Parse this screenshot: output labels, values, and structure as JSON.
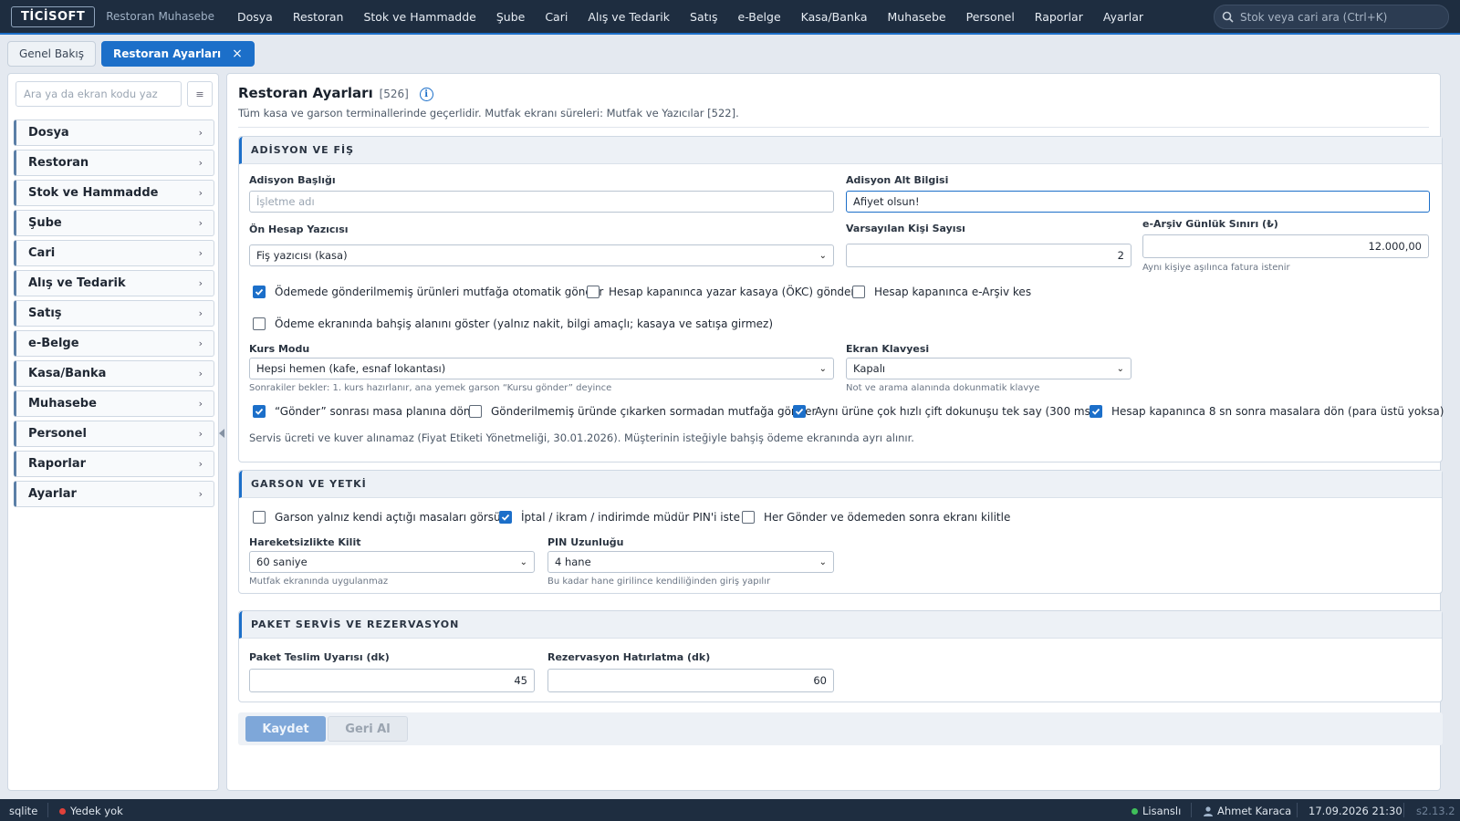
{
  "app": {
    "logo": "TİCİSOFT",
    "name": "Restoran Muhasebe"
  },
  "menu": [
    "Dosya",
    "Restoran",
    "Stok ve Hammadde",
    "Şube",
    "Cari",
    "Alış ve Tedarik",
    "Satış",
    "e-Belge",
    "Kasa/Banka",
    "Muhasebe",
    "Personel",
    "Raporlar",
    "Ayarlar"
  ],
  "search": {
    "placeholder": "Stok veya cari ara (Ctrl+K)"
  },
  "tabs": [
    {
      "label": "Genel Bakış",
      "active": false
    },
    {
      "label": "Restoran Ayarları",
      "active": true,
      "close": "×"
    }
  ],
  "sidebar": {
    "search_placeholder": "Ara ya da ekran kodu yaz",
    "items": [
      "Dosya",
      "Restoran",
      "Stok ve Hammadde",
      "Şube",
      "Cari",
      "Alış ve Tedarik",
      "Satış",
      "e-Belge",
      "Kasa/Banka",
      "Muhasebe",
      "Personel",
      "Raporlar",
      "Ayarlar"
    ]
  },
  "page": {
    "title": "Restoran Ayarları",
    "code": "[526]",
    "subtitle": "Tüm kasa ve garson terminallerinde geçerlidir. Mutfak ekranı süreleri: Mutfak ve Yazıcılar [522]."
  },
  "adisyon": {
    "heading": "ADİSYON VE FİŞ",
    "baslik_label": "Adisyon Başlığı",
    "baslik_placeholder": "İşletme adı",
    "baslik_value": "",
    "altbilgi_label": "Adisyon Alt Bilgisi",
    "altbilgi_value": "Afiyet olsun!",
    "yazici_label": "Ön Hesap Yazıcısı",
    "yazici_value": "Fiş yazıcısı (kasa)",
    "kisi_label": "Varsayılan Kişi Sayısı",
    "kisi_value": "2",
    "earsiv_label": "e-Arşiv Günlük Sınırı (₺)",
    "earsiv_value": "12.000,00",
    "earsiv_hint": "Aynı kişiye aşılınca fatura istenir",
    "checks1": [
      {
        "label": "Ödemede gönderilmemiş ürünleri mutfağa otomatik gönder",
        "checked": true
      },
      {
        "label": "Hesap kapanınca yazar kasaya (ÖKC) gönder",
        "checked": false
      },
      {
        "label": "Hesap kapanınca e-Arşiv kes",
        "checked": false
      },
      {
        "label": "Ödeme ekranında bahşiş alanını göster (yalnız nakit, bilgi amaçlı; kasaya ve satışa girmez)",
        "checked": false
      }
    ],
    "kurs_label": "Kurs Modu",
    "kurs_value": "Hepsi hemen (kafe, esnaf lokantası)",
    "kurs_hint": "Sonrakiler bekler: 1. kurs hazırlanır, ana yemek garson “Kursu gönder” deyince",
    "klavye_label": "Ekran Klavyesi",
    "klavye_value": "Kapalı",
    "klavye_hint": "Not ve arama alanında dokunmatik klavye",
    "checks2": [
      {
        "label": "“Gönder” sonrası masa planına dön",
        "checked": true
      },
      {
        "label": "Gönderilmemiş üründe çıkarken sormadan mutfağa gönder",
        "checked": false
      },
      {
        "label": "Aynı ürüne çok hızlı çift dokunuşu tek say (300 ms)",
        "checked": true
      },
      {
        "label": "Hesap kapanınca 8 sn sonra masalara dön (para üstü yoksa)",
        "checked": true
      }
    ],
    "note": "Servis ücreti ve kuver alınamaz (Fiyat Etiketi Yönetmeliği, 30.01.2026). Müşterinin isteğiyle bahşiş ödeme ekranında ayrı alınır."
  },
  "garson": {
    "heading": "GARSON VE YETKİ",
    "checks": [
      {
        "label": "Garson yalnız kendi açtığı masaları görsün",
        "checked": false
      },
      {
        "label": "İptal / ikram / indirimde müdür PIN'i iste",
        "checked": true
      },
      {
        "label": "Her Gönder ve ödemeden sonra ekranı kilitle",
        "checked": false
      }
    ],
    "kilit_label": "Hareketsizlikte Kilit",
    "kilit_value": "60 saniye",
    "kilit_hint": "Mutfak ekranında uygulanmaz",
    "pin_label": "PIN Uzunluğu",
    "pin_value": "4 hane",
    "pin_hint": "Bu kadar hane girilince kendiliğinden giriş yapılır"
  },
  "paket": {
    "heading": "PAKET SERVİS VE REZERVASYON",
    "teslim_label": "Paket Teslim Uyarısı (dk)",
    "teslim_value": "45",
    "rez_label": "Rezervasyon Hatırlatma (dk)",
    "rez_value": "60"
  },
  "actions": {
    "save": "Kaydet",
    "revert": "Geri Al"
  },
  "status": {
    "db": "sqlite",
    "backup": "Yedek yok",
    "license": "Lisanslı",
    "user": "Ahmet Karaca",
    "datetime": "17.09.2026 21:30",
    "version": "s2.13.2"
  },
  "colors": {
    "accent": "#1c6fc9",
    "topbar": "#1e2d40",
    "ok": "#3fbf5a",
    "warn": "#e0413a"
  }
}
